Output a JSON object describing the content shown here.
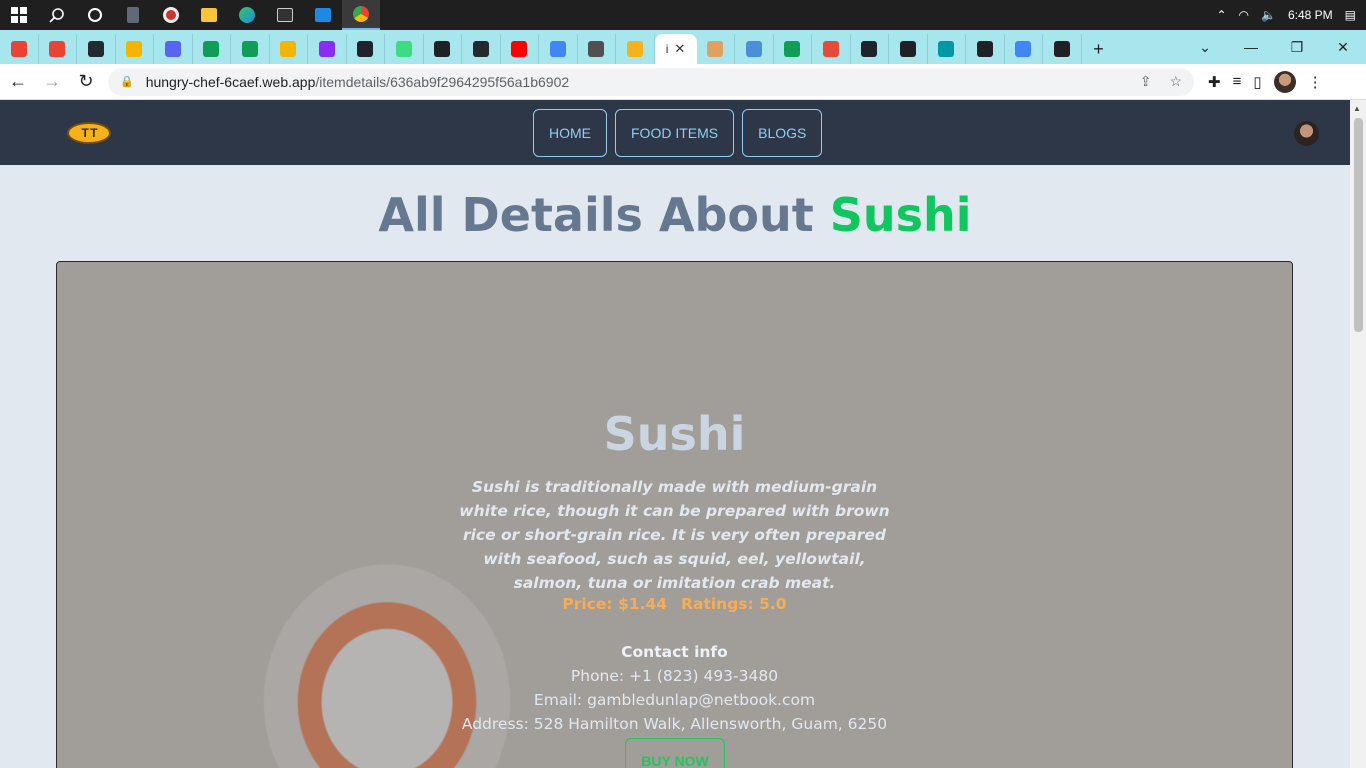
{
  "taskbar": {
    "time": "6:48 PM",
    "icons": [
      "windows-start",
      "search",
      "cortana",
      "calculator",
      "media",
      "file-explorer",
      "edge",
      "terminal",
      "vscode",
      "chrome"
    ]
  },
  "tabs": {
    "active_label": "i",
    "favicons": [
      {
        "name": "gmail",
        "color": "#ea4335"
      },
      {
        "name": "gmail",
        "color": "#ea4335"
      },
      {
        "name": "github",
        "color": "#24292f"
      },
      {
        "name": "slides",
        "color": "#f4b400"
      },
      {
        "name": "discord",
        "color": "#5865f2"
      },
      {
        "name": "sheets",
        "color": "#0f9d58"
      },
      {
        "name": "sheets",
        "color": "#0f9d58"
      },
      {
        "name": "slides",
        "color": "#f4b400"
      },
      {
        "name": "video",
        "color": "#8b2cf5"
      },
      {
        "name": "react",
        "color": "#20232a"
      },
      {
        "name": "chat",
        "color": "#3ddc84"
      },
      {
        "name": "globe",
        "color": "#202124"
      },
      {
        "name": "github",
        "color": "#24292f"
      },
      {
        "name": "youtube",
        "color": "#ff0000"
      },
      {
        "name": "google",
        "color": "#4285f4"
      },
      {
        "name": "academy",
        "color": "#505050"
      },
      {
        "name": "flower",
        "color": "#f6b21b"
      }
    ],
    "favicons_after": [
      {
        "name": "dog",
        "color": "#e0a060"
      },
      {
        "name": "lwc",
        "color": "#4a90d9"
      },
      {
        "name": "drive",
        "color": "#0f9d58"
      },
      {
        "name": "arrow",
        "color": "#e84a3a"
      },
      {
        "name": "react",
        "color": "#20232a"
      },
      {
        "name": "globe",
        "color": "#202124"
      },
      {
        "name": "diamond",
        "color": "#0097a7"
      },
      {
        "name": "mui",
        "color": "#202124"
      },
      {
        "name": "google",
        "color": "#4285f4"
      },
      {
        "name": "mui",
        "color": "#202124"
      }
    ]
  },
  "address_bar": {
    "domain": "hungry-chef-6caef.web.app",
    "path": "/itemdetails/636ab9f2964295f56a1b6902"
  },
  "site_nav": {
    "links": [
      "HOME",
      "FOOD ITEMS",
      "BLOGS"
    ]
  },
  "page": {
    "heading_prefix": "All Details About",
    "heading_accent": "Sushi"
  },
  "item": {
    "title": "Sushi",
    "description": "Sushi is traditionally made with medium-grain white rice, though it can be prepared with brown rice or short-grain rice. It is very often prepared with seafood, such as squid, eel, yellowtail, salmon, tuna or imitation crab meat.",
    "price": "Price: $1.44",
    "ratings": "Ratings: 5.0",
    "contact_title": "Contact info",
    "phone": "Phone: +1 (823) 493-3480",
    "email": "Email: gambledunlap@netbook.com",
    "address": "Address: 528 Hamilton Walk, Allensworth, Guam, 6250",
    "buy_label": "BUY NOW"
  },
  "colors": {
    "nav_bg": "#2d3748",
    "accent_green": "#10c65f",
    "price_orange": "#f6ad55",
    "link_blue": "#90cdf4"
  }
}
